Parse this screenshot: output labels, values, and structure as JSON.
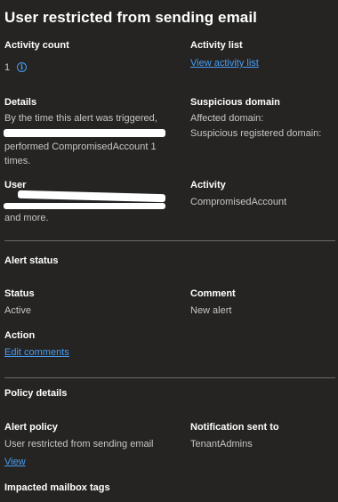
{
  "title": "User restricted from sending email",
  "activity_count": {
    "label": "Activity count",
    "value": "1"
  },
  "activity_list": {
    "label": "Activity list",
    "link": "View activity list"
  },
  "details": {
    "label": "Details",
    "line1": "By the time this alert was triggered,",
    "line2": "performed CompromisedAccount 1",
    "line3": "times."
  },
  "suspicious_domain": {
    "label": "Suspicious domain",
    "affected": "Affected domain:",
    "registered": "Suspicious registered domain:"
  },
  "user": {
    "label": "User",
    "more": "and more."
  },
  "activity": {
    "label": "Activity",
    "value": "CompromisedAccount"
  },
  "alert_status": {
    "header": "Alert status",
    "status_label": "Status",
    "status_value": "Active",
    "comment_label": "Comment",
    "comment_value": "New alert",
    "action_label": "Action",
    "action_link": "Edit comments"
  },
  "policy_details": {
    "header": "Policy details",
    "alert_policy_label": "Alert policy",
    "alert_policy_value": "User restricted from sending email",
    "view_link": "View",
    "notification_label": "Notification sent to",
    "notification_value": "TenantAdmins"
  },
  "impacted_tags": {
    "label": "Impacted mailbox tags"
  },
  "icons": {
    "info": "info-icon"
  },
  "colors": {
    "background": "#252423",
    "link": "#479ef5",
    "heading": "#ffffff",
    "text": "#c8c6c4"
  }
}
